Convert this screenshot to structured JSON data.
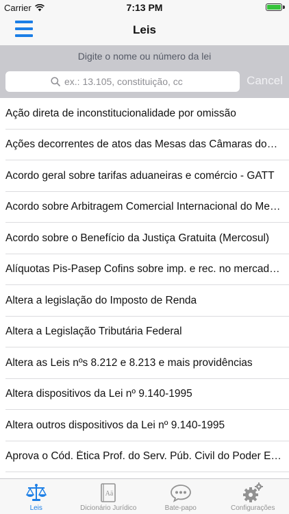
{
  "status_bar": {
    "carrier": "Carrier",
    "time": "7:13 PM",
    "battery_level": 1.0
  },
  "nav": {
    "title": "Leis",
    "menu_icon": "hamburger-menu-icon"
  },
  "search": {
    "prompt": "Digite o nome ou número da lei",
    "placeholder": "ex.: 13.105, constituição, cc",
    "value": "",
    "cancel_label": "Cancel"
  },
  "laws": [
    "Ação direta de inconstitucionalidade por omissão",
    "Ações decorrentes de atos das Mesas das Câmaras dos Deputados",
    "Acordo geral sobre tarifas aduaneiras e comércio - GATT",
    "Acordo sobre Arbitragem Comercial Internacional do Mercosul",
    "Acordo sobre o Benefício da Justiça Gratuita (Mercosul)",
    "Alíquotas Pis-Pasep Cofins sobre imp. e rec. no mercado interno",
    "Altera a legislação do Imposto de Renda",
    "Altera a Legislação Tributária Federal",
    "Altera as Leis nºs 8.212 e 8.213 e mais providências",
    "Altera dispositivos da Lei nº 9.140-1995",
    "Altera outros dispositivos da Lei nº 9.140-1995",
    "Aprova o Cód. Ética Prof. do Serv. Púb. Civil do Poder Executivo"
  ],
  "tabs": [
    {
      "label": "Leis",
      "icon": "scales-icon",
      "active": true
    },
    {
      "label": "Dicionário Jurídico",
      "icon": "dictionary-icon",
      "active": false
    },
    {
      "label": "Bate-papo",
      "icon": "chat-bubble-icon",
      "active": false
    },
    {
      "label": "Configurações",
      "icon": "gear-icon",
      "active": false
    }
  ],
  "colors": {
    "accent": "#1b7ee6",
    "inactive": "#929292",
    "search_bg": "#c9c9ce",
    "bar_bg": "#f7f7f7"
  }
}
